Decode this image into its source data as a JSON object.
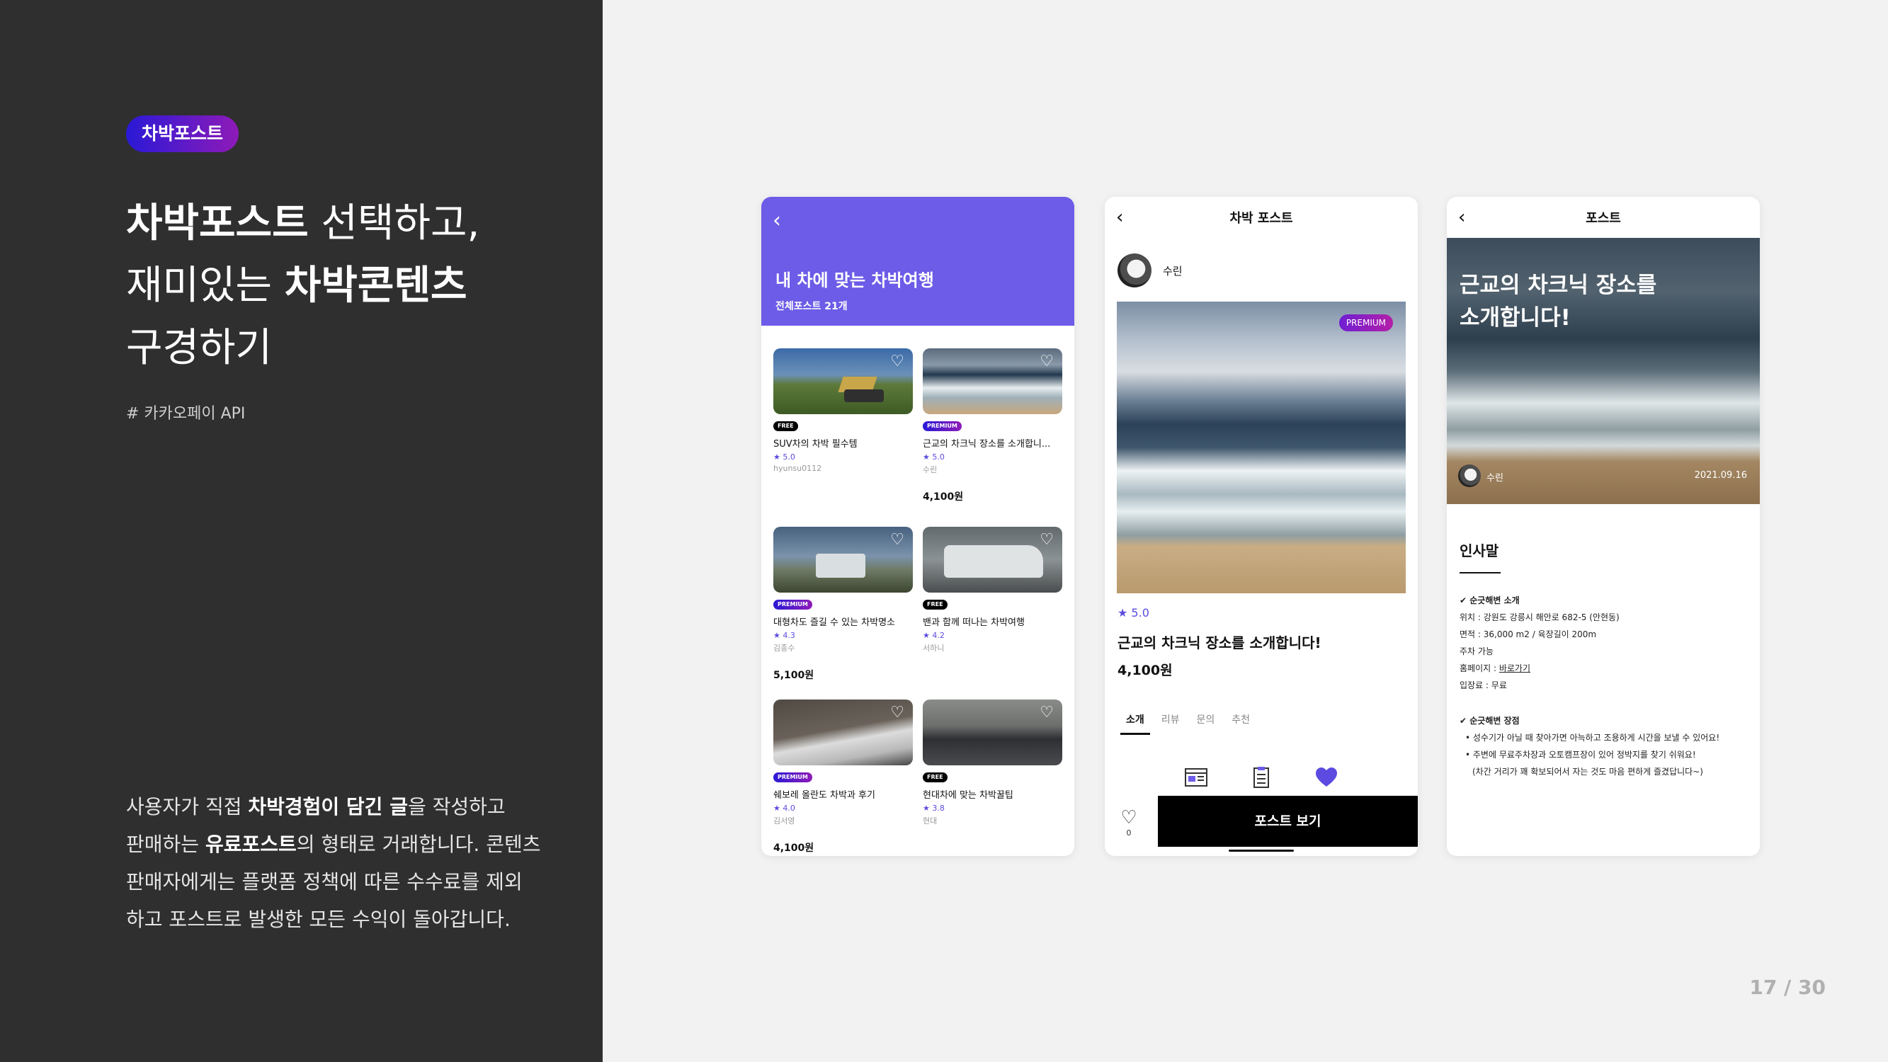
{
  "left": {
    "badge": "차박포스트",
    "headline": {
      "l1_bold": "차박포스트",
      "l1_rest": " 선택하고,",
      "l2_pre": "재미있는 ",
      "l2_bold": "차박콘텐츠",
      "l3": "구경하기"
    },
    "api_tag": "# 카카오페이 API",
    "desc": {
      "p1": "사용자가 직접 ",
      "b1": "차박경험이 담긴 글",
      "p2": "을 작성하고",
      "p3": "판매하는 ",
      "b2": "유료포스트",
      "p4": "의 형태로 거래합니다. 콘텐츠",
      "p5": "판매자에게는 플랫폼 정책에 따른 수수료를 제외",
      "p6": "하고 포스트로 발생한 모든 수익이 돌아갑니다."
    }
  },
  "page_number": "17 / 30",
  "phone1": {
    "back_icon": "‹",
    "title": "내 차에 맞는 차박여행",
    "subtitle": "전체포스트 21개",
    "cards": [
      {
        "tag": "FREE",
        "title": "SUV차의 차박 필수템",
        "rating": "★ 5.0",
        "user": "hyunsu0112",
        "price": ""
      },
      {
        "tag": "PREMIUM",
        "title": "근교의 차크닉 장소를 소개합니...",
        "rating": "★ 5.0",
        "user": "수린",
        "price": "4,100원"
      },
      {
        "tag": "PREMIUM",
        "title": "대형차도 즐길 수 있는 차박명소",
        "rating": "★ 4.3",
        "user": "김종수",
        "price": "5,100원"
      },
      {
        "tag": "FREE",
        "title": "밴과 함께 떠나는 차박여행",
        "rating": "★ 4.2",
        "user": "서하니",
        "price": ""
      },
      {
        "tag": "PREMIUM",
        "title": "쉐보레 올란도 차박과 후기",
        "rating": "★ 4.0",
        "user": "김서영",
        "price": "4,100원"
      },
      {
        "tag": "FREE",
        "title": "현대차에 맞는 차박꿀팁",
        "rating": "★ 3.8",
        "user": "현대",
        "price": ""
      }
    ]
  },
  "phone2": {
    "title": "차박 포스트",
    "back_icon": "‹",
    "user": "수린",
    "badge": "PREMIUM",
    "rating": "★ 5.0",
    "post_title": "근교의 차크닉 장소를 소개합니다!",
    "price": "4,100원",
    "tabs": [
      "소개",
      "리뷰",
      "문의",
      "추천"
    ],
    "like_count": "0",
    "button": "포스트 보기"
  },
  "phone3": {
    "title": "포스트",
    "back_icon": "‹",
    "hero_l1": "근교의 차크닉 장소를",
    "hero_l2": "소개합니다!",
    "user": "수린",
    "date": "2021.09.16",
    "greeting": "인사말",
    "sec1_head": "✔ 순긋해변 소개",
    "sec1": [
      "위치 : 강원도 강릉시 해안로 682-5 (안현동)",
      "면적 : 36,000 m2 / 육장길이 200m",
      "주차 가능"
    ],
    "homepage_label": "홈페이지 : ",
    "homepage_link": "바로가기",
    "fee": "입장료 : 무료",
    "sec2_head": "✔ 순긋해변 장점",
    "sec2": [
      "•  성수기가 아닐 때 찾아가면 아늑하고 조용하게 시간을 보낼 수 있어요!",
      "•  주변에 무료주차장과 오토캠프장이 있어 정박지를 찾기 쉬워요!",
      "(차간 거리가 꽤 확보되어서 자는 것도 마음 편하게 즐겼답니다~)"
    ]
  }
}
